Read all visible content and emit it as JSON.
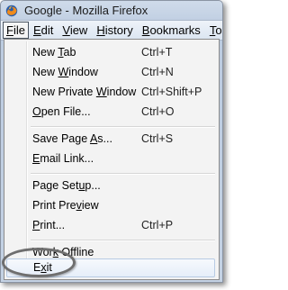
{
  "window": {
    "title": "Google - Mozilla Firefox"
  },
  "menubar": {
    "file_pre": "",
    "file_ul": "F",
    "file_post": "ile",
    "edit_ul": "E",
    "edit_post": "dit",
    "view_ul": "V",
    "view_post": "iew",
    "history_ul": "H",
    "history_post": "istory",
    "bookmarks_ul": "B",
    "bookmarks_post": "ookmarks",
    "tools_ul": "T",
    "tools_post": "o"
  },
  "file_menu": {
    "new_tab": {
      "pre": "New ",
      "ul": "T",
      "post": "ab",
      "accel": "Ctrl+T"
    },
    "new_window": {
      "pre": "New ",
      "ul": "W",
      "post": "indow",
      "accel": "Ctrl+N"
    },
    "new_private": {
      "pre": "New Private ",
      "ul": "W",
      "post": "indow",
      "accel": "Ctrl+Shift+P"
    },
    "open_file": {
      "pre": "",
      "ul": "O",
      "post": "pen File...",
      "accel": "Ctrl+O"
    },
    "save_page": {
      "pre": "Save Page ",
      "ul": "A",
      "post": "s...",
      "accel": "Ctrl+S"
    },
    "email_link": {
      "pre": "",
      "ul": "E",
      "post": "mail Link...",
      "accel": ""
    },
    "page_setup": {
      "pre": "Page Set",
      "ul": "u",
      "post": "p...",
      "accel": ""
    },
    "print_preview": {
      "pre": "Print Pre",
      "ul": "v",
      "post": "iew",
      "accel": ""
    },
    "print": {
      "pre": "",
      "ul": "P",
      "post": "rint...",
      "accel": "Ctrl+P"
    },
    "work_offline": {
      "pre": "Wor",
      "ul": "k",
      "post": " Offline",
      "accel": ""
    },
    "exit": {
      "pre": "E",
      "ul": "x",
      "post": "it",
      "accel": ""
    }
  }
}
